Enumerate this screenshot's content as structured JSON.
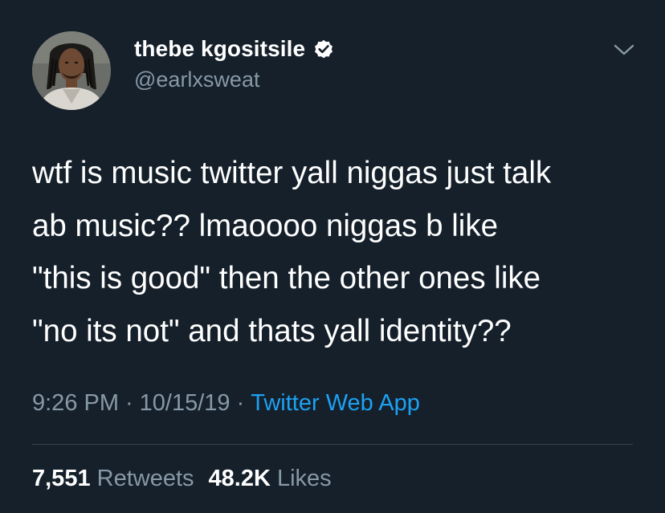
{
  "author": {
    "display_name": "thebe kgositsile",
    "handle": "@earlxsweat",
    "verified": true,
    "avatar_icon": "profile-photo"
  },
  "menu_icon": "chevron-down-icon",
  "tweet": {
    "text": "wtf is music twitter yall niggas just talk\nab music?? lmaoooo  niggas b like\n\"this is good\" then the other ones like\n\"no its not\" and thats yall identity??"
  },
  "meta": {
    "time": "9:26 PM",
    "separator": "·",
    "date": "10/15/19",
    "source": "Twitter Web App"
  },
  "stats": {
    "retweets_count": "7,551",
    "retweets_label": "Retweets",
    "likes_count": "48.2K",
    "likes_label": "Likes"
  },
  "colors": {
    "background": "#15202b",
    "text": "#ffffff",
    "secondary": "#8899a6",
    "link": "#1da1f2",
    "divider": "#38444d"
  }
}
